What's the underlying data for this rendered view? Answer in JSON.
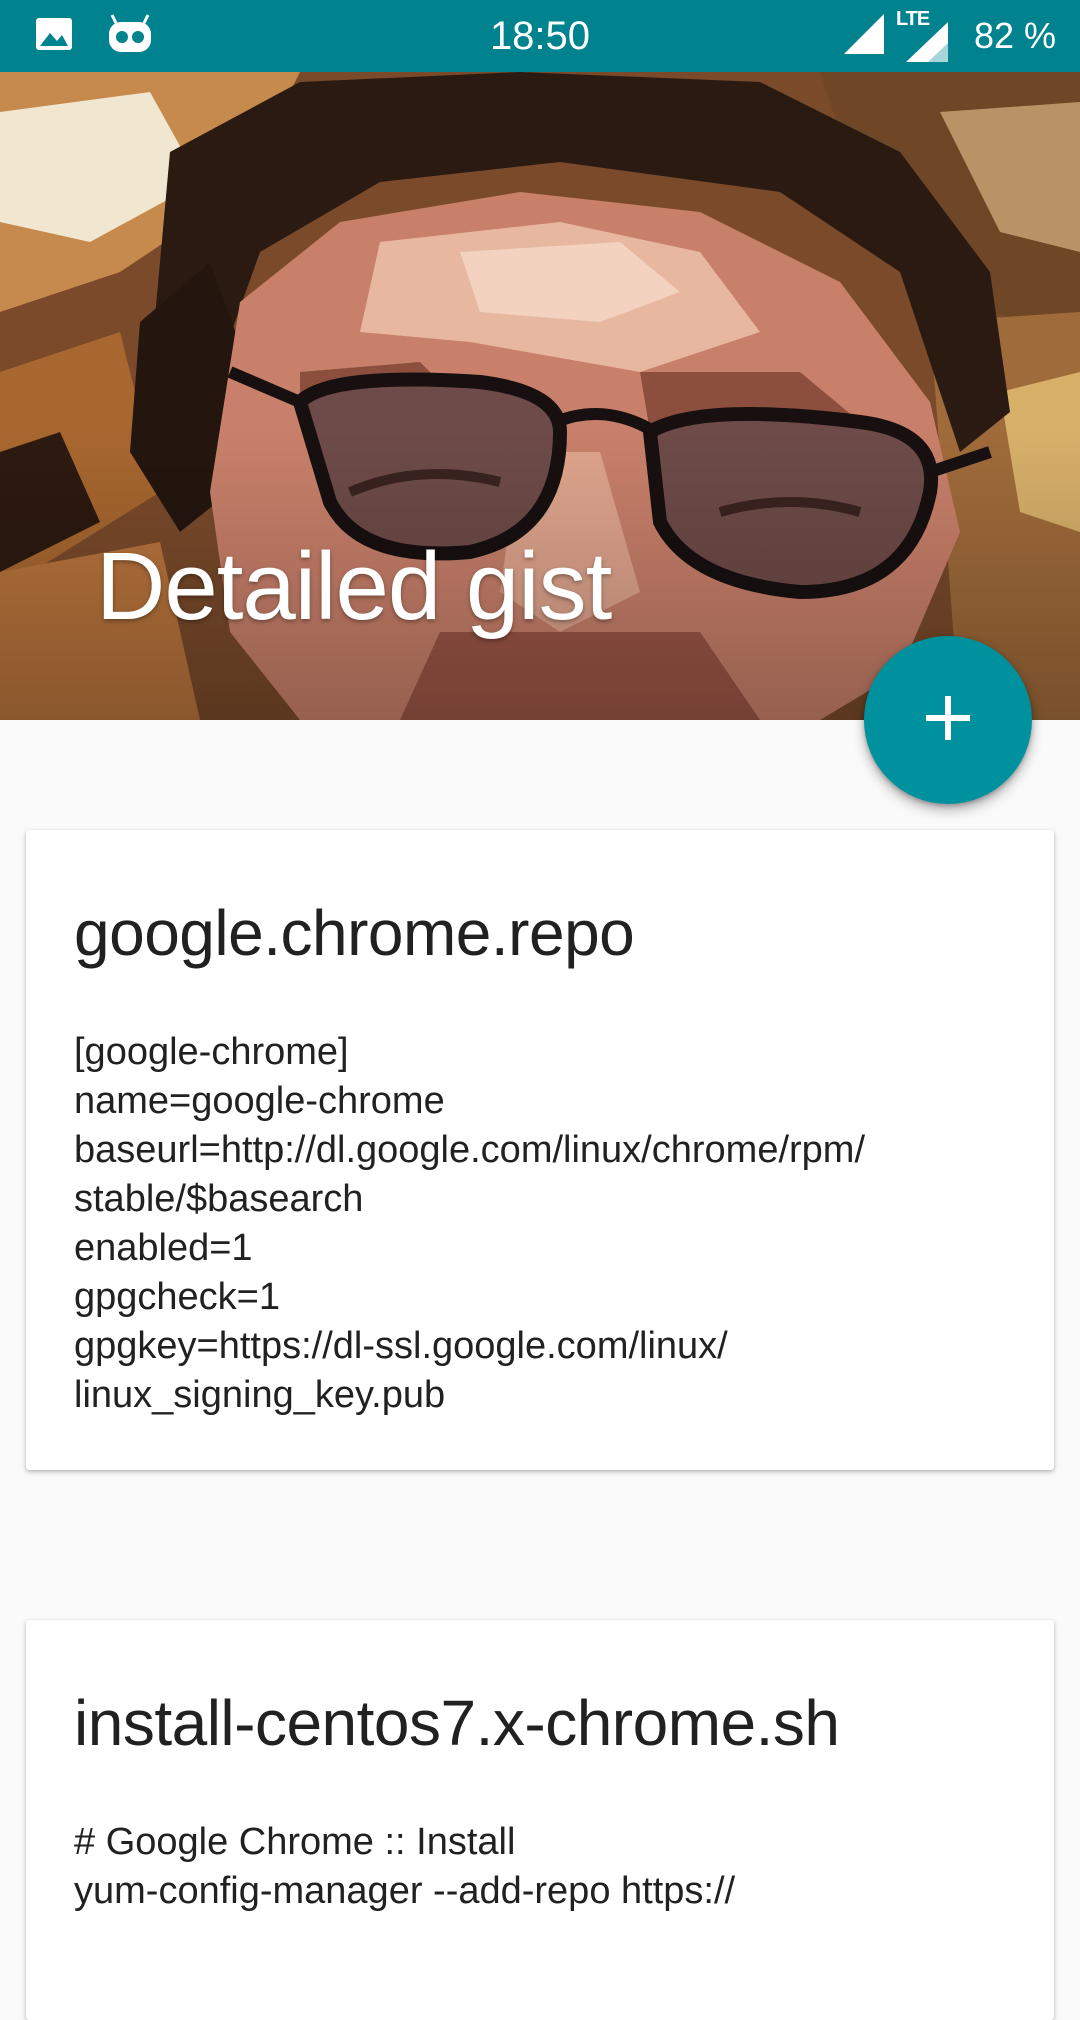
{
  "status_bar": {
    "time": "18:50",
    "network_type": "LTE",
    "battery": "82 %",
    "background_color": "#00838f",
    "left_icons": [
      "image-icon",
      "cyanogen-mascot-icon"
    ],
    "right_icons": [
      "signal-icon",
      "lte-signal-icon"
    ]
  },
  "header": {
    "title": "Detailed gist"
  },
  "fab": {
    "icon": "plus-icon",
    "color": "#00919e"
  },
  "gists": [
    {
      "title": "google.chrome.repo",
      "lines": [
        "[google-chrome]",
        "name=google-chrome",
        "baseurl=http://dl.google.com/linux/chrome/rpm/",
        "stable/$basearch",
        "enabled=1",
        "gpgcheck=1",
        "gpgkey=https://dl-ssl.google.com/linux/",
        "linux_signing_key.pub"
      ]
    },
    {
      "title": "install-centos7.x-chrome.sh",
      "lines": [
        "# Google Chrome :: Install",
        "yum-config-manager --add-repo https://"
      ]
    }
  ]
}
